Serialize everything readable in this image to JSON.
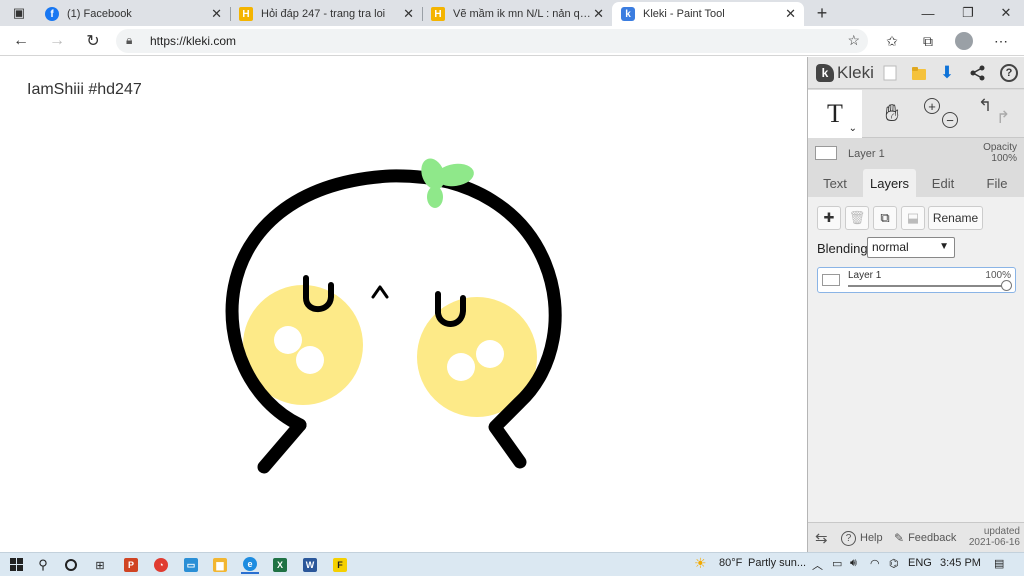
{
  "browser": {
    "tabs": [
      {
        "title": "(1) Facebook",
        "favicon": "facebook-icon",
        "color": "#1877f2"
      },
      {
        "title": "Hỏi đáp 247 - trang tra loi",
        "favicon": "hoidap-icon",
        "color": "#f4b400"
      },
      {
        "title": "Vẽ mầm ik mn N/L : nản quá,học",
        "favicon": "hoidap-icon",
        "color": "#f4b400"
      },
      {
        "title": "Kleki - Paint Tool",
        "favicon": "kleki-icon",
        "color": "#3b7de0",
        "active": true
      }
    ],
    "url": "https://kleki.com"
  },
  "canvas": {
    "caption": "IamShiii #hd247"
  },
  "panel": {
    "logo": "Kleki",
    "current_layer": {
      "name": "Layer 1",
      "opacity_label": "Opacity",
      "opacity_value": "100%"
    },
    "tabs": [
      "Text",
      "Layers",
      "Edit",
      "File"
    ],
    "active_tab": "Layers",
    "rename_label": "Rename",
    "blending_label": "Blending",
    "blending_value": "normal",
    "layers": [
      {
        "name": "Layer 1",
        "opacity": "100%"
      }
    ],
    "footer": {
      "help": "Help",
      "feedback": "Feedback",
      "updated_label": "updated",
      "updated_date": "2021-06-16"
    }
  },
  "taskbar": {
    "weather_temp": "80°F",
    "weather_desc": "Partly sun...",
    "language": "ENG",
    "time": "3:45 PM"
  },
  "colors": {
    "stroke": "#000000",
    "cheek": "#fdea88",
    "sprout": "#8fe88a",
    "accent_blue": "#0f73d8"
  }
}
